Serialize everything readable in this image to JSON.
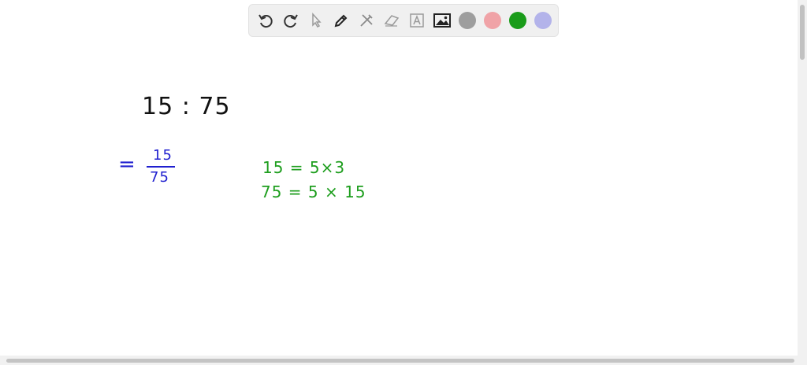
{
  "toolbar": {
    "tools": [
      "undo-icon",
      "redo-icon",
      "pointer-icon",
      "pen-icon",
      "tools-icon",
      "eraser-icon",
      "text-icon",
      "image-icon"
    ],
    "colors": [
      "#9e9e9e",
      "#f0a3a7",
      "#1a9c1a",
      "#b3b3ea"
    ]
  },
  "canvas": {
    "ratio_text": "15 : 75",
    "equals_sign": "=",
    "fraction": {
      "numerator": "15",
      "denominator": "75"
    },
    "factor_line_1": "15 = 5×3",
    "factor_line_2": "75 = 5 × 15",
    "ink_colors": {
      "black": "#111111",
      "blue": "#1f1fcf",
      "green": "#1e9e1e"
    }
  }
}
